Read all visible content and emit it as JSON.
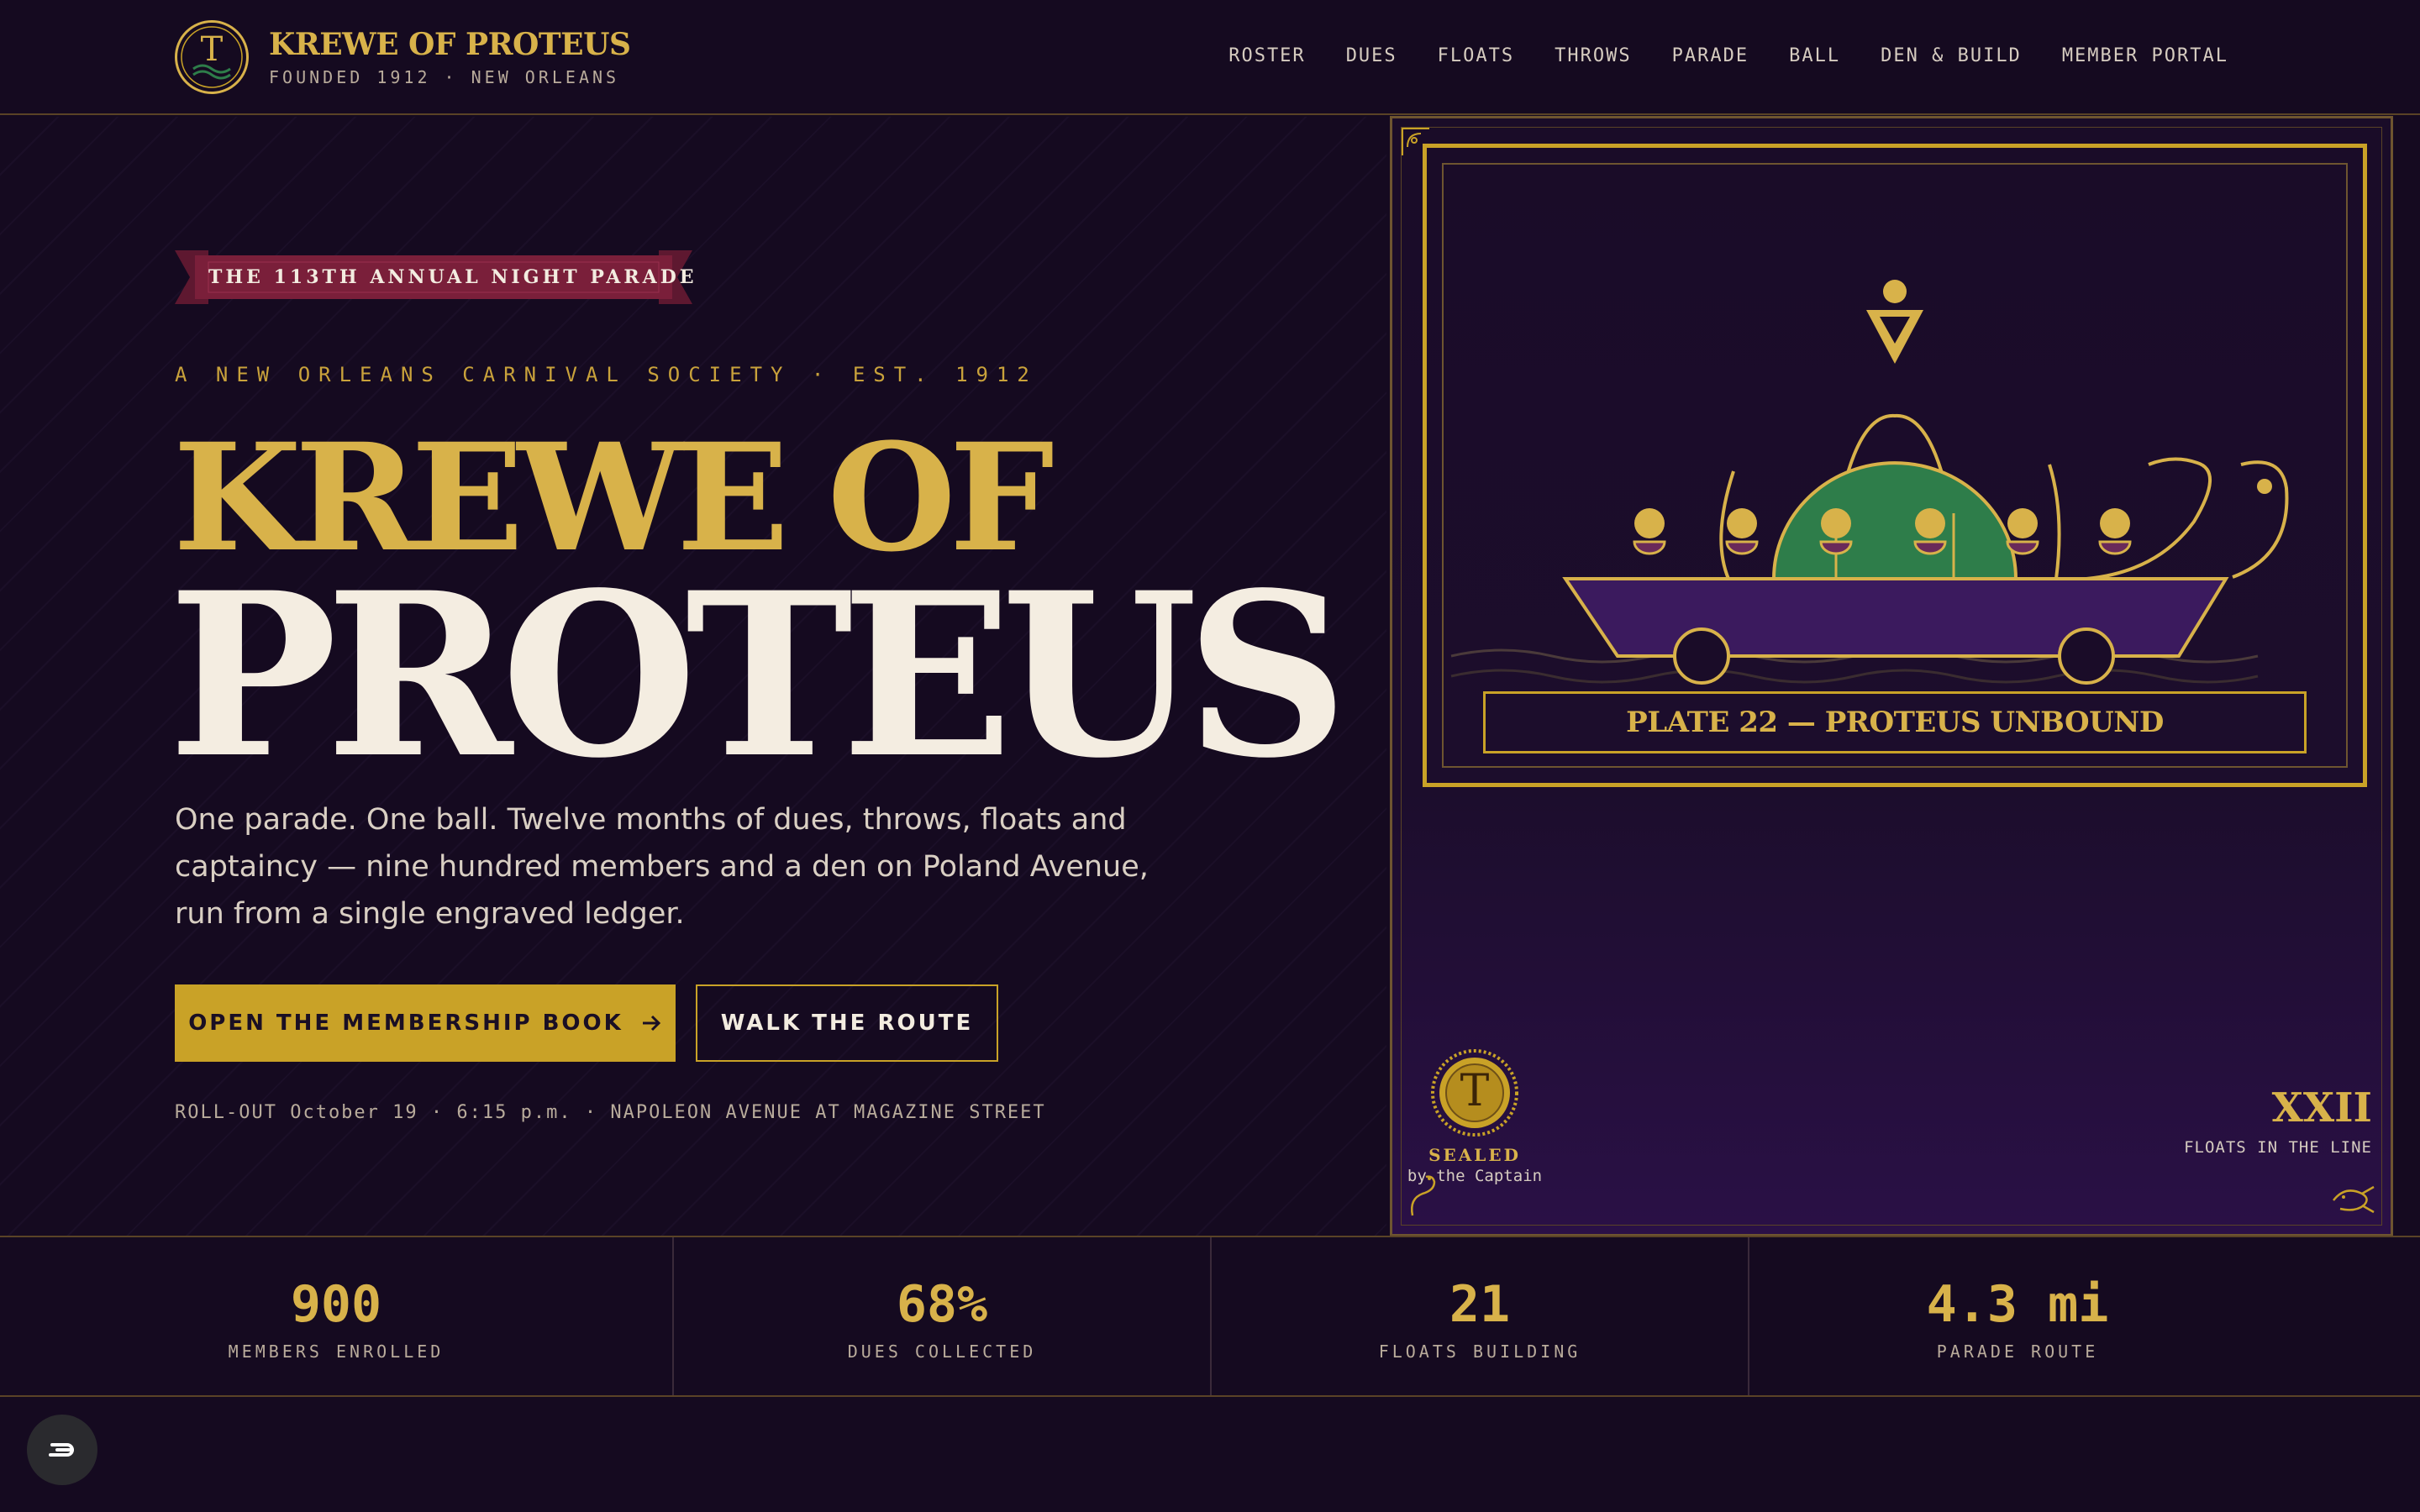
{
  "header": {
    "brand_title": "KREWE OF PROTEUS",
    "brand_subtitle": "FOUNDED 1912 · NEW ORLEANS",
    "logo_letter": "T",
    "nav": [
      "ROSTER",
      "DUES",
      "FLOATS",
      "THROWS",
      "PARADE",
      "BALL",
      "DEN & BUILD",
      "MEMBER PORTAL"
    ]
  },
  "hero": {
    "ribbon": "THE 113TH ANNUAL NIGHT PARADE",
    "eyebrow": "A NEW ORLEANS CARNIVAL SOCIETY · EST. 1912",
    "title_line1": "KREWE OF",
    "title_line2": "PROTEUS",
    "lede": "One parade. One ball. Twelve months of dues, throws, floats and captaincy — nine hundred members and a den on Poland Avenue, run from a single engraved ledger.",
    "primary_button": "OPEN THE MEMBERSHIP BOOK",
    "secondary_button": "WALK THE ROUTE",
    "rollout": "ROLL-OUT October 19 · 6:15 p.m. · NAPOLEON AVENUE AT MAGAZINE STREET"
  },
  "plate": {
    "caption": "PLATE 22 — PROTEUS UNBOUND",
    "seal_letter": "T",
    "seal_label": "SEALED",
    "seal_sub": "by the Captain",
    "numeral": "XXII",
    "numeral_sub": "FLOATS IN THE LINE"
  },
  "stats": [
    {
      "value": "900",
      "label": "MEMBERS ENROLLED"
    },
    {
      "value": "68%",
      "label": "DUES COLLECTED"
    },
    {
      "value": "21",
      "label": "FLOATS BUILDING"
    },
    {
      "value": "4.3 mi",
      "label": "PARADE ROUTE"
    }
  ],
  "colors": {
    "background": "#150a20",
    "gold": "#d8b24a",
    "button_gold": "#c9a227",
    "ribbon": "#7a1f3a",
    "float_green": "#2e7d4a",
    "float_purple": "#3b1a5e"
  }
}
